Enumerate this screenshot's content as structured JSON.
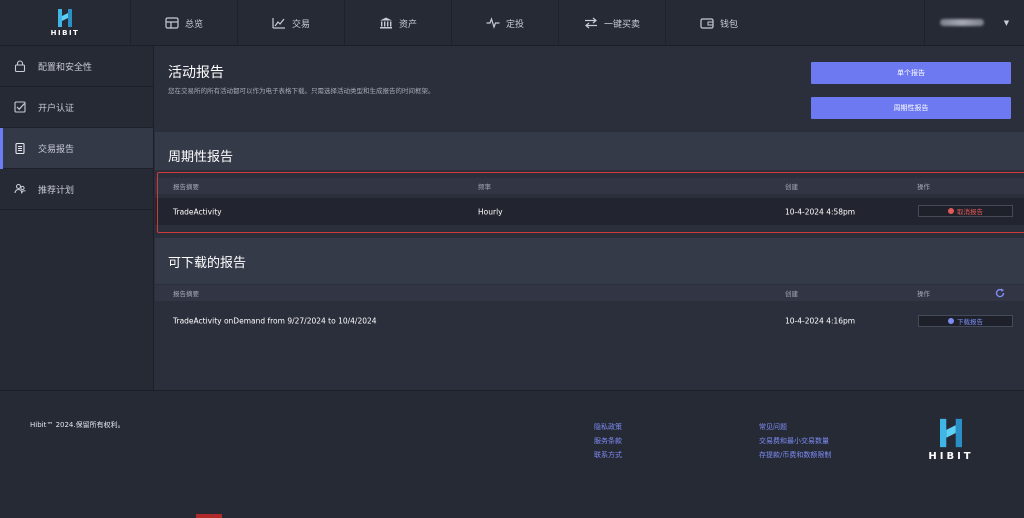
{
  "brand": {
    "name": "HIBIT",
    "accent": "#3fb6e6"
  },
  "nav": {
    "items": [
      {
        "label": "总览",
        "icon": "dashboard-icon"
      },
      {
        "label": "交易",
        "icon": "chart-line-icon"
      },
      {
        "label": "资产",
        "icon": "bank-icon"
      },
      {
        "label": "定投",
        "icon": "pulse-icon"
      },
      {
        "label": "一键买卖",
        "icon": "swap-icon"
      },
      {
        "label": "钱包",
        "icon": "wallet-icon"
      }
    ]
  },
  "sidebar": {
    "items": [
      {
        "label": "配置和安全性",
        "icon": "lock-icon"
      },
      {
        "label": "开户认证",
        "icon": "checkbox-icon"
      },
      {
        "label": "交易报告",
        "icon": "clipboard-icon"
      },
      {
        "label": "推荐计划",
        "icon": "users-icon"
      }
    ],
    "active_index": 2
  },
  "activity": {
    "title": "活动报告",
    "description": "您在交易所的所有活动都可以作为电子表格下载。只需选择活动类型和生成报告的时间框架。",
    "btn_single": "单个报告",
    "btn_periodic": "周期性报告"
  },
  "periodic": {
    "title": "周期性报告",
    "columns": {
      "summary": "报告摘要",
      "frequency": "频率",
      "created": "创建",
      "action": "操作"
    },
    "rows": [
      {
        "summary": "TradeActivity",
        "frequency": "Hourly",
        "created": "10-4-2024 4:58pm",
        "action": "取消报告"
      }
    ]
  },
  "downloadable": {
    "title": "可下载的报告",
    "columns": {
      "summary": "报告摘要",
      "created": "创建",
      "action": "操作"
    },
    "rows": [
      {
        "summary": "TradeActivity onDemand from 9/27/2024 to 10/4/2024",
        "created": "10-4-2024 4:16pm",
        "action": "下载报告"
      }
    ]
  },
  "footer": {
    "copyright": "Hibit™ 2024.保留所有权利。",
    "links_col1": [
      "隐私政策",
      "服务条款",
      "联系方式"
    ],
    "links_col2": [
      "常见问题",
      "交易费和最小交易数量",
      "存提款/币费和数额限制"
    ],
    "logo_text": "HIBIT"
  },
  "colors": {
    "primary_button": "#6c79f0",
    "link": "#7e8cf5",
    "danger": "#e35858",
    "highlight_border": "#d13a3a"
  }
}
